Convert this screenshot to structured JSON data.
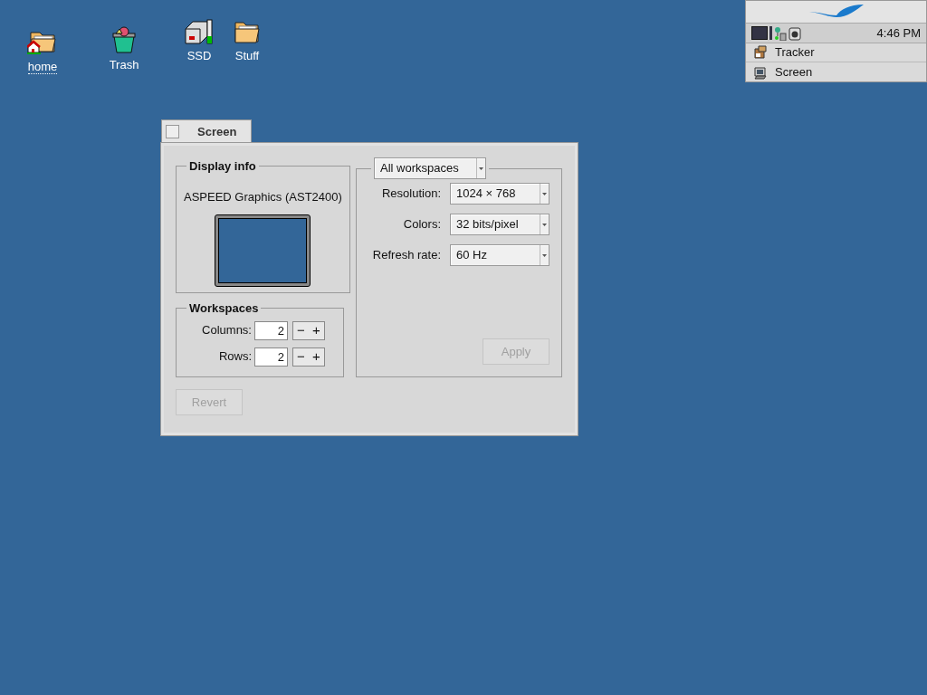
{
  "desktop_icons": [
    {
      "label": "home",
      "kind": "home"
    },
    {
      "label": "Trash",
      "kind": "trash"
    },
    {
      "label": "SSD",
      "kind": "drive"
    },
    {
      "label": "Stuff",
      "kind": "folder"
    }
  ],
  "deskbar": {
    "clock": "4:46 PM",
    "apps": [
      {
        "label": "Tracker",
        "kind": "tracker"
      },
      {
        "label": "Screen",
        "kind": "screen"
      }
    ]
  },
  "window": {
    "title": "Screen",
    "display_info": {
      "title": "Display info",
      "device": "ASPEED Graphics (AST2400)"
    },
    "workspaces": {
      "title": "Workspaces",
      "fields": [
        {
          "label": "Columns:",
          "value": "2",
          "minus": "−",
          "plus": "+"
        },
        {
          "label": "Rows:",
          "value": "2",
          "minus": "−",
          "plus": "+"
        }
      ]
    },
    "revert": {
      "label": "Revert",
      "disabled": true
    },
    "scope": "All workspaces",
    "settings": [
      {
        "label": "Resolution:",
        "value": "1024 × 768"
      },
      {
        "label": "Colors:",
        "value": "32 bits/pixel"
      },
      {
        "label": "Refresh rate:",
        "value": "60 Hz"
      }
    ],
    "apply": {
      "label": "Apply",
      "disabled": true
    }
  }
}
